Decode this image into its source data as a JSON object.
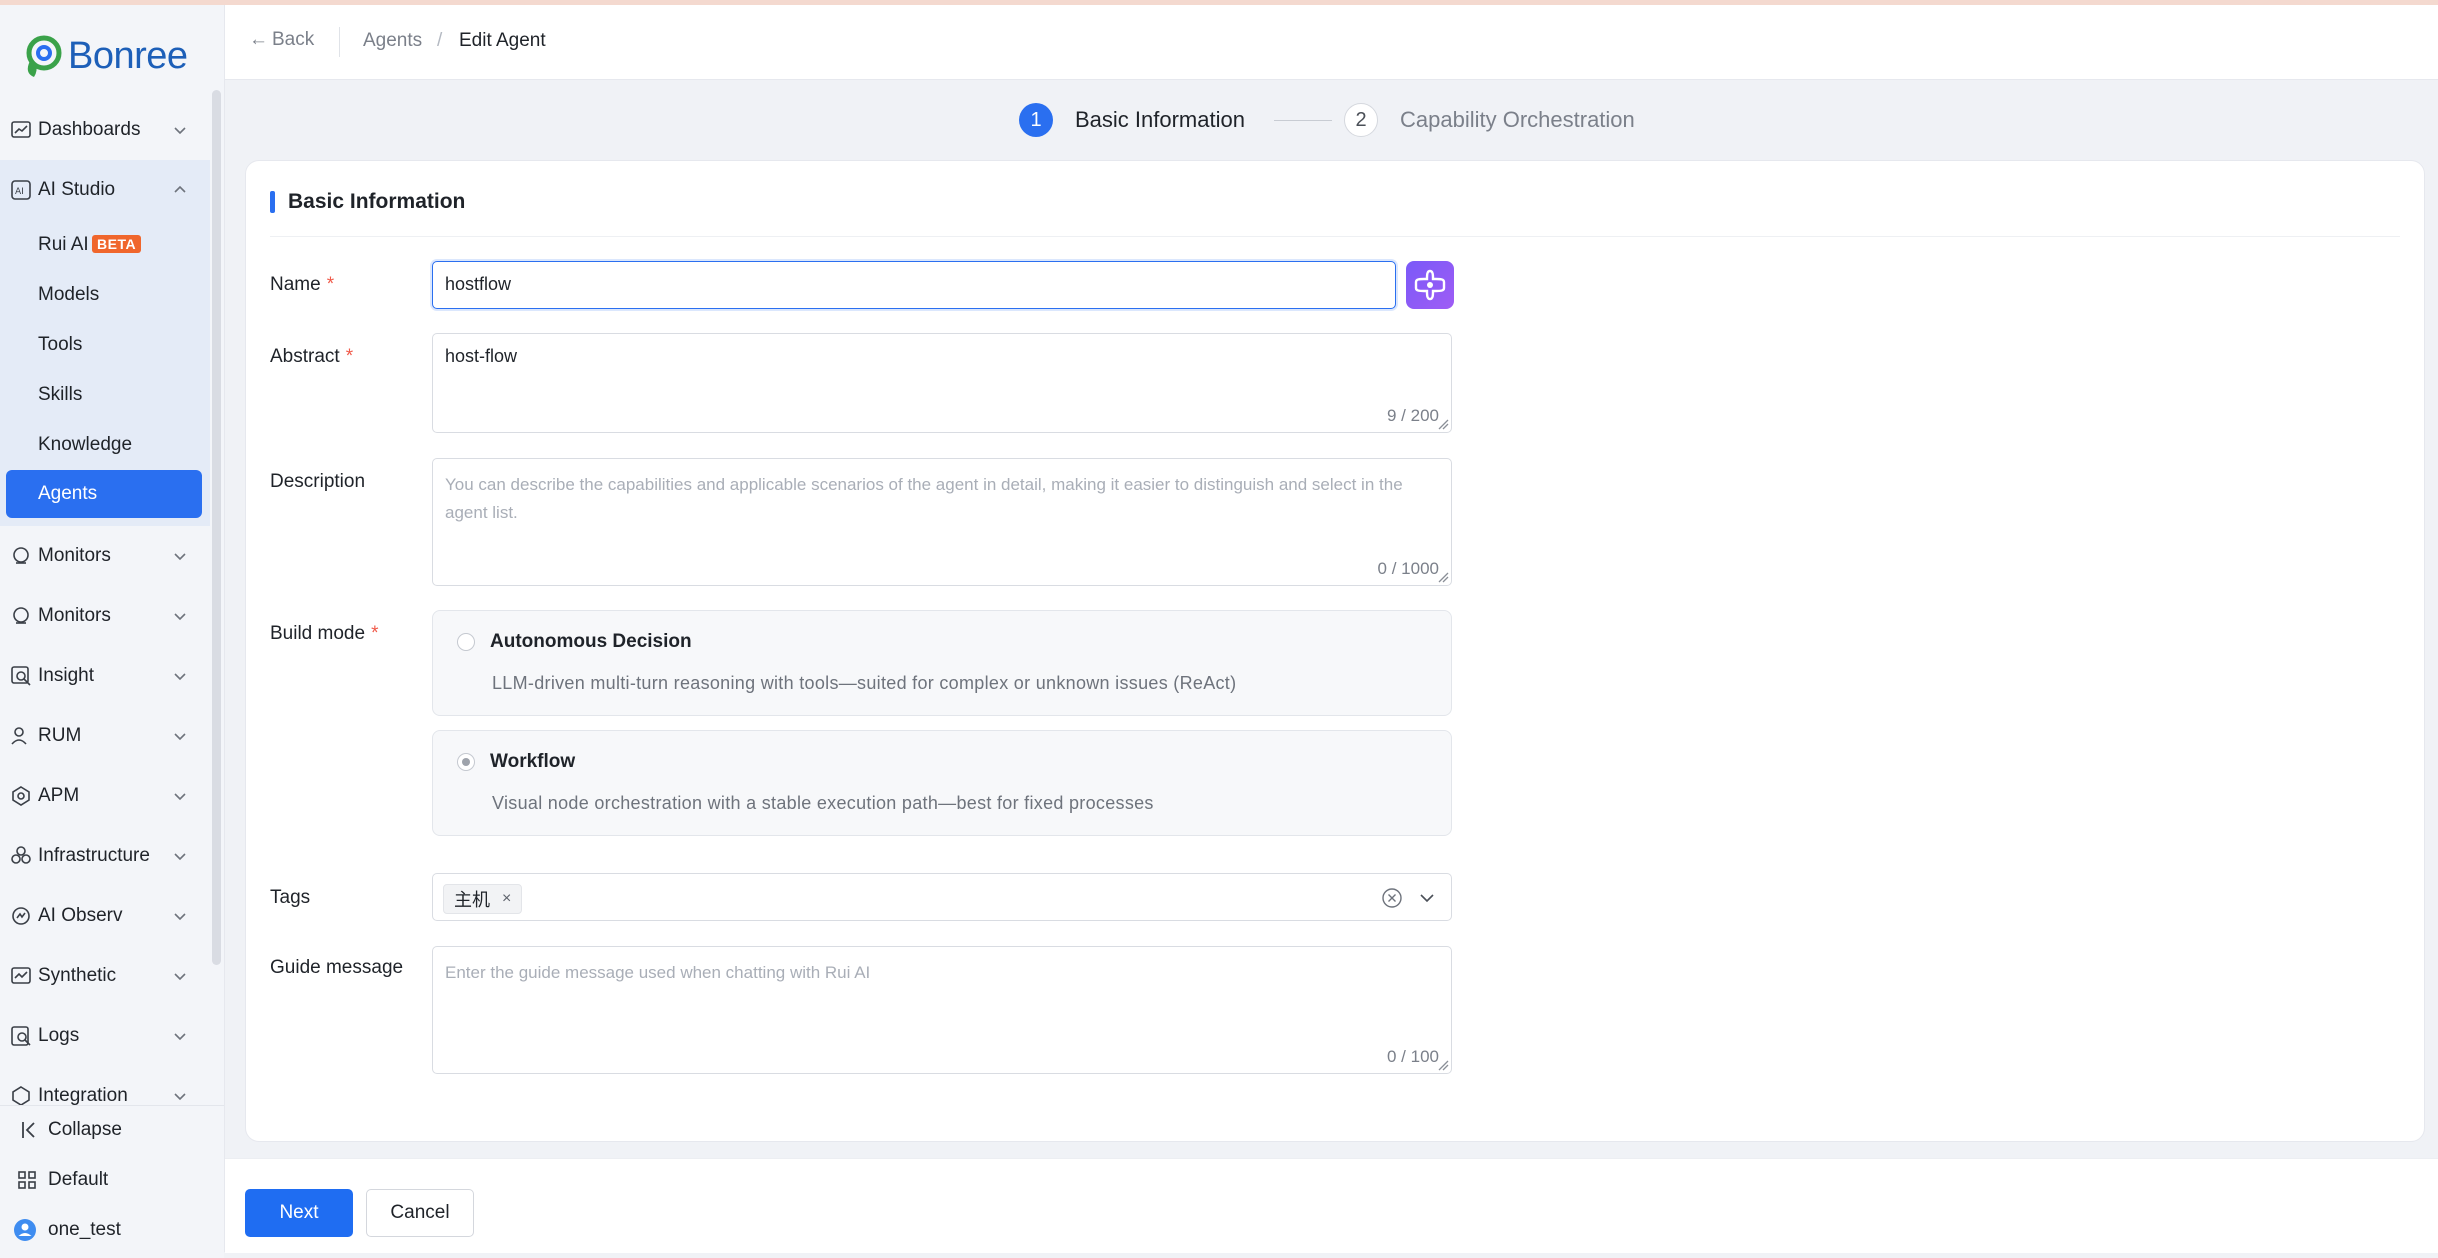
{
  "brand": {
    "logo_text": "Bonree"
  },
  "sidebar": {
    "groups_top": [
      {
        "label": "Dashboards",
        "icon": "dashboard-icon"
      }
    ],
    "ai_studio": {
      "label": "AI Studio",
      "icon": "ai-studio-icon",
      "items": [
        {
          "label": "Rui AI",
          "badge": "BETA"
        },
        {
          "label": "Models"
        },
        {
          "label": "Tools"
        },
        {
          "label": "Skills"
        },
        {
          "label": "Knowledge"
        },
        {
          "label": "Agents",
          "active": true
        }
      ]
    },
    "groups": [
      {
        "label": "Monitors",
        "icon": "monitor-icon"
      },
      {
        "label": "Monitors",
        "icon": "monitor-icon"
      },
      {
        "label": "Insight",
        "icon": "insight-icon"
      },
      {
        "label": "RUM",
        "icon": "rum-icon"
      },
      {
        "label": "APM",
        "icon": "apm-icon"
      },
      {
        "label": "Infrastructure",
        "icon": "infrastructure-icon"
      },
      {
        "label": "AI Observ",
        "icon": "ai-observ-icon"
      },
      {
        "label": "Synthetic",
        "icon": "synthetic-icon"
      },
      {
        "label": "Logs",
        "icon": "logs-icon"
      },
      {
        "label": "Integration",
        "icon": "integration-icon"
      }
    ],
    "bottom": {
      "collapse": "Collapse",
      "workspace": "Default",
      "user": "one_test"
    }
  },
  "header": {
    "back": "Back",
    "breadcrumb": [
      "Agents",
      "Edit Agent"
    ],
    "breadcrumb_sep": "/"
  },
  "steps": [
    {
      "number": "1",
      "label": "Basic Information",
      "active": true
    },
    {
      "number": "2",
      "label": "Capability Orchestration",
      "active": false
    }
  ],
  "form": {
    "section_title": "Basic Information",
    "name": {
      "label": "Name",
      "required_mark": "*",
      "value": "hostflow"
    },
    "abstract": {
      "label": "Abstract",
      "required_mark": "*",
      "value": "host-flow",
      "counter": "9 / 200"
    },
    "description": {
      "label": "Description",
      "placeholder": "You can describe the capabilities and applicable scenarios of the agent in detail, making it easier to distinguish and select in the agent list.",
      "counter": "0 / 1000"
    },
    "build_mode": {
      "label": "Build mode",
      "required_mark": "*",
      "options": [
        {
          "title": "Autonomous Decision",
          "desc": "LLM-driven multi-turn reasoning with tools—suited for complex or unknown issues (ReAct)",
          "checked": false
        },
        {
          "title": "Workflow",
          "desc": "Visual node orchestration with a stable execution path—best for fixed processes",
          "checked": true
        }
      ]
    },
    "tags": {
      "label": "Tags",
      "values": [
        "主机"
      ],
      "remove_glyph": "×"
    },
    "guide_message": {
      "label": "Guide message",
      "placeholder": "Enter the guide message used when chatting with Rui AI",
      "counter": "0 / 100"
    }
  },
  "footer": {
    "next": "Next",
    "cancel": "Cancel"
  },
  "colors": {
    "primary": "#2a6ff0",
    "beta": "#f0662c",
    "magic": "#8b5cf6",
    "required": "#f05a4a"
  }
}
